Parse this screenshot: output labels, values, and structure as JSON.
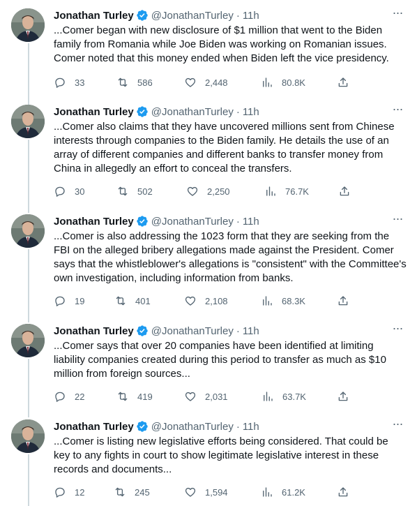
{
  "author": {
    "display_name": "Jonathan Turley",
    "handle": "@JonathanTurley",
    "dot": "·",
    "more": "···"
  },
  "tweets": [
    {
      "time": "11h",
      "text": "...Comer began with new disclosure of $1 million that went to the Biden family from Romania while Joe Biden was working on Romanian issues. Comer noted that this money ended when Biden left the vice presidency.",
      "replies": "33",
      "reposts": "586",
      "likes": "2,448",
      "views": "80.8K"
    },
    {
      "time": "11h",
      "text": "...Comer also claims that they have uncovered millions sent from Chinese interests through companies to the Biden family. He details the use of an array of different companies and different banks to transfer money from China in allegedly an effort to conceal the transfers.",
      "replies": "30",
      "reposts": "502",
      "likes": "2,250",
      "views": "76.7K"
    },
    {
      "time": "11h",
      "text": "...Comer is also addressing the 1023 form that they are seeking from the FBI on the alleged bribery allegations made against the President. Comer says that the whistleblower's allegations is \"consistent\" with the Committee's own investigation, including information from banks.",
      "replies": "19",
      "reposts": "401",
      "likes": "2,108",
      "views": "68.3K"
    },
    {
      "time": "11h",
      "text": "...Comer says that over 20 companies have been identified at limiting liability companies created during this period to transfer as much as $10 million from foreign sources...",
      "replies": "22",
      "reposts": "419",
      "likes": "2,031",
      "views": "63.7K"
    },
    {
      "time": "11h",
      "text": "...Comer is listing new legislative efforts being considered. That could be key to any fights in court to show legitimate legislative interest in these records and documents...",
      "replies": "12",
      "reposts": "245",
      "likes": "1,594",
      "views": "61.2K"
    }
  ],
  "icons": {
    "verified": "verified-badge-icon",
    "reply": "reply-icon",
    "repost": "repost-icon",
    "like": "heart-icon",
    "views": "views-chart-icon",
    "share": "share-icon",
    "more": "more-icon"
  },
  "colors": {
    "text": "#0f1419",
    "secondary": "#536471",
    "verified": "#1d9bf0",
    "thread_line": "#cfd9de"
  }
}
